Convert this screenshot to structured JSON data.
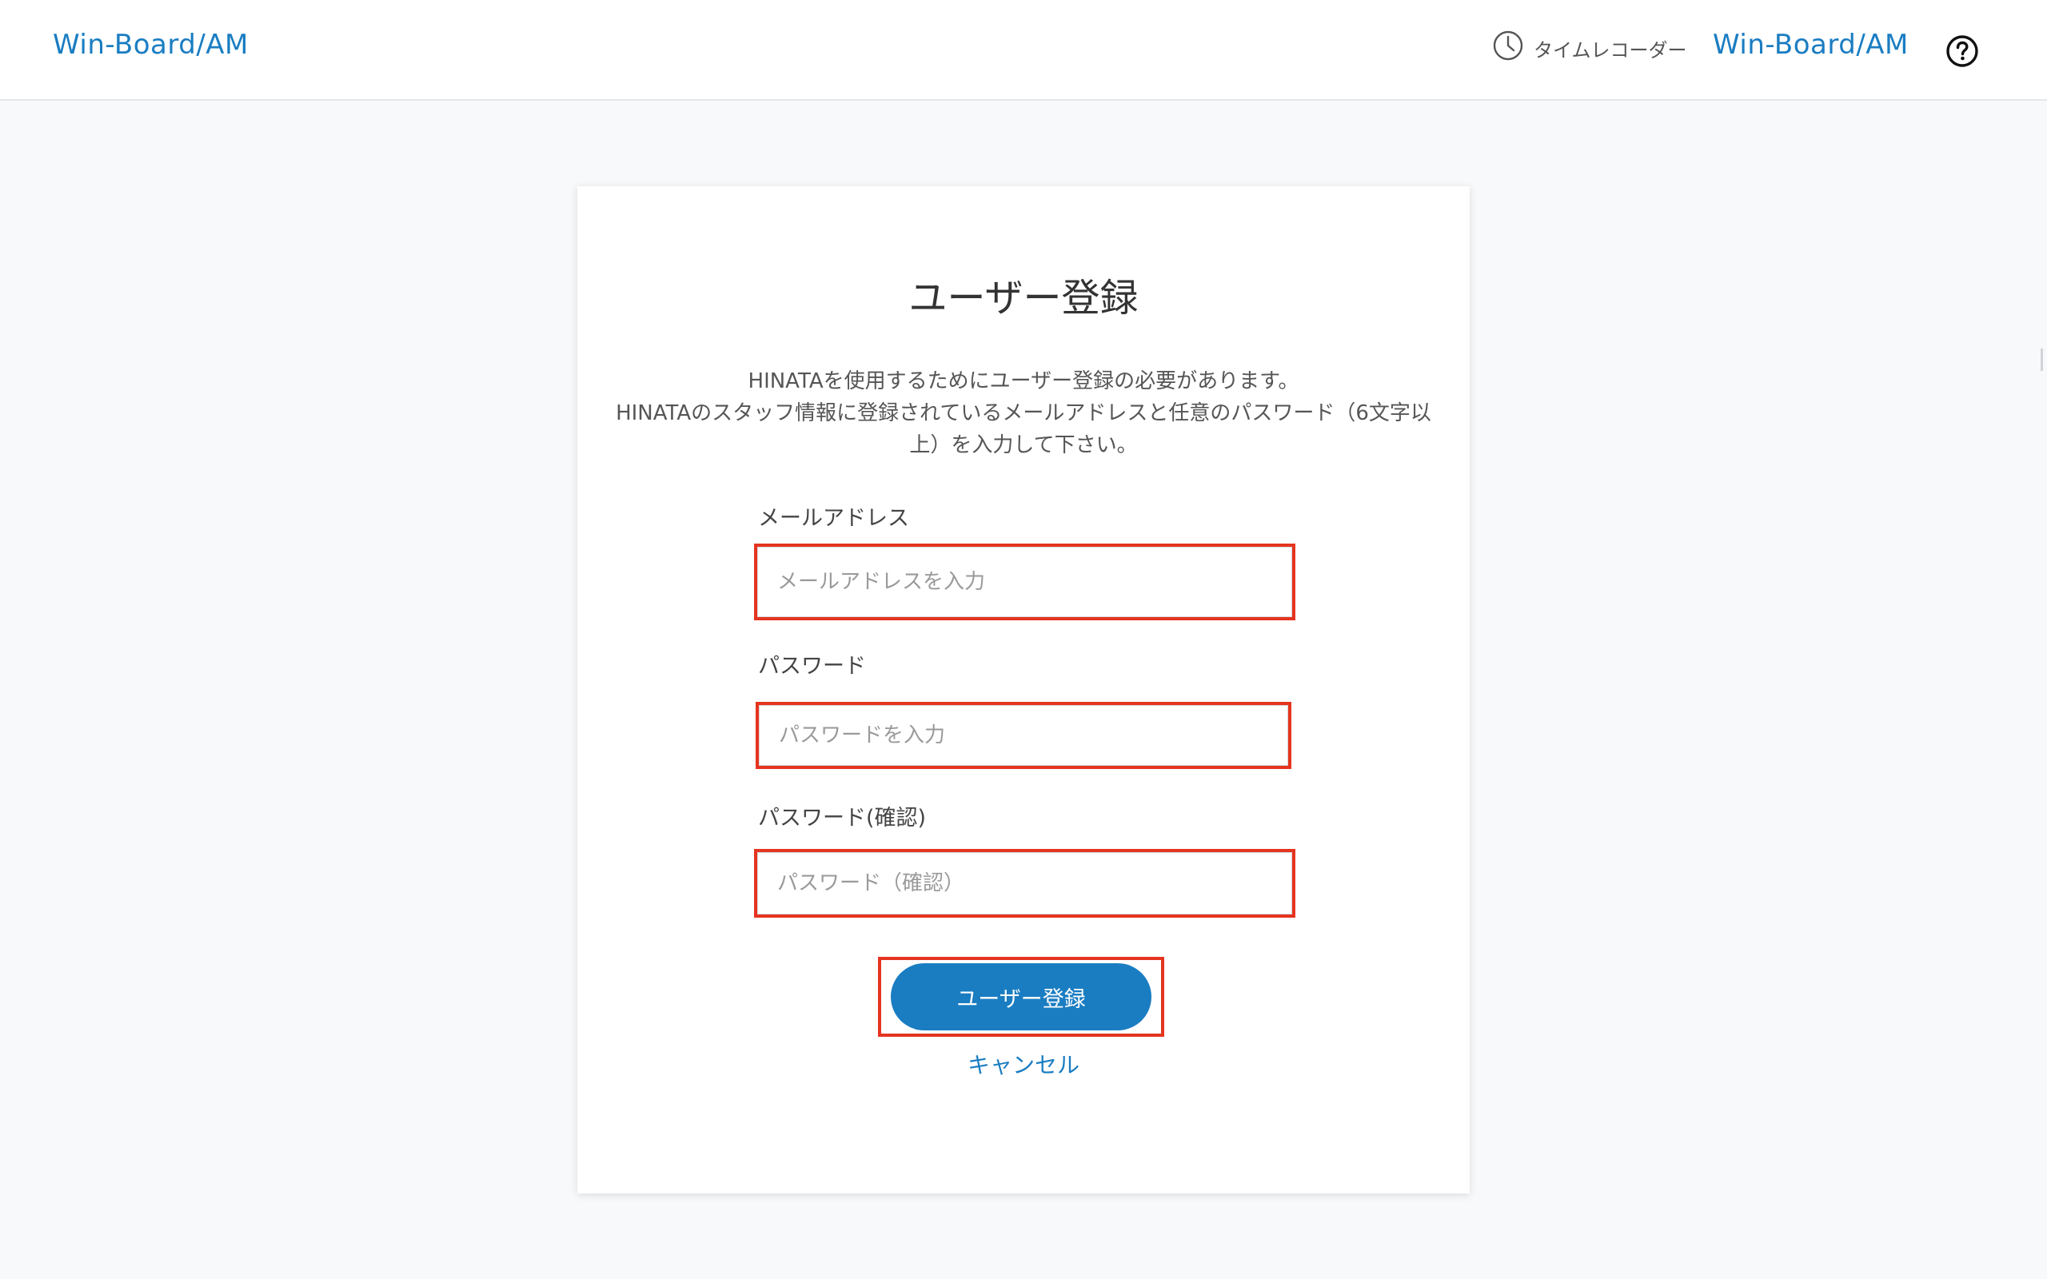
{
  "header": {
    "brand_left": "Win-Board/AM",
    "time_recorder_label": "タイムレコーダー",
    "brand_right": "Win-Board/AM",
    "help_icon": "question-circle-icon",
    "clock_icon": "clock-icon"
  },
  "form": {
    "title": "ユーザー登録",
    "description_line1": "HINATAを使用するためにユーザー登録の必要があります。",
    "description_line2": "HINATAのスタッフ情報に登録されているメールアドレスと任意のパスワード（6文字以上）を入力して下さい。",
    "email": {
      "label": "メールアドレス",
      "placeholder": "メールアドレスを入力",
      "value": ""
    },
    "password": {
      "label": "パスワード",
      "placeholder": "パスワードを入力",
      "value": ""
    },
    "password_confirm": {
      "label": "パスワード(確認)",
      "placeholder": "パスワード（確認）",
      "value": ""
    },
    "submit_label": "ユーザー登録",
    "cancel_label": "キャンセル"
  },
  "colors": {
    "accent": "#1a7dc2",
    "highlight": "#e5341f",
    "background": "#f8f9fb"
  }
}
